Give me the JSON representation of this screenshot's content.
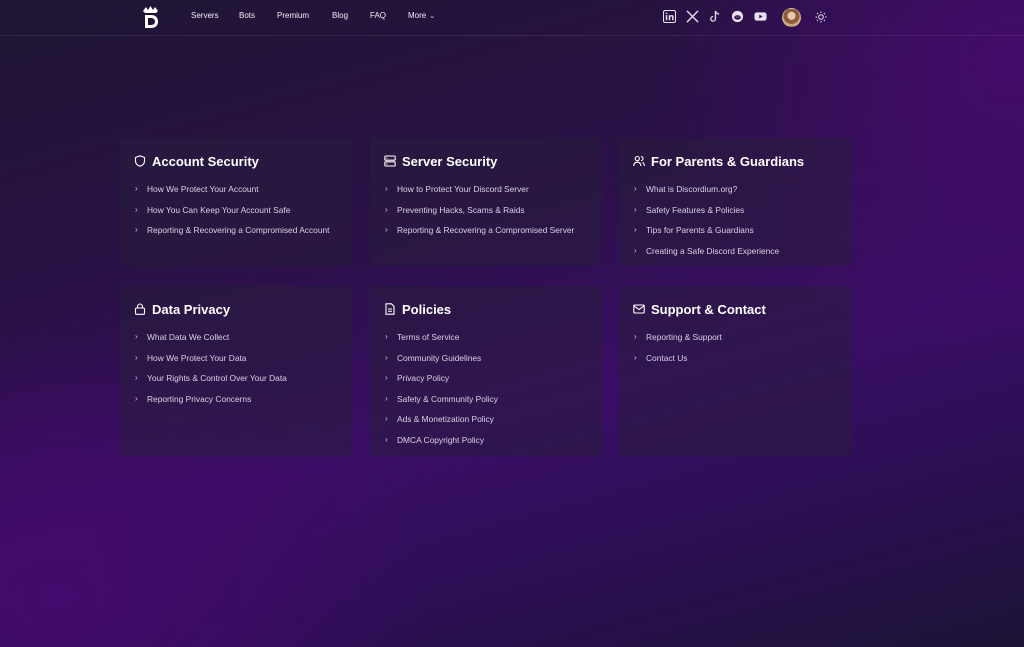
{
  "nav": {
    "items": [
      "Servers",
      "Bots",
      "Premium",
      "Blog",
      "FAQ"
    ],
    "more_label": "More",
    "socials": [
      "linkedin-icon",
      "x-icon",
      "tiktok-icon",
      "reddit-icon",
      "youtube-icon"
    ],
    "theme_icon": "sun-icon"
  },
  "cards": [
    {
      "title": "Account Security",
      "icon": "shield-icon",
      "links": [
        "How We Protect Your Account",
        "How You Can Keep Your Account Safe",
        "Reporting & Recovering a Compromised Account"
      ]
    },
    {
      "title": "Server Security",
      "icon": "server-icon",
      "links": [
        "How to Protect Your Discord Server",
        "Preventing Hacks, Scams & Raids",
        "Reporting & Recovering a Compromised Server"
      ]
    },
    {
      "title": "For Parents & Guardians",
      "icon": "users-icon",
      "links": [
        "What is Discordium.org?",
        "Safety Features & Policies",
        "Tips for Parents & Guardians",
        "Creating a Safe Discord Experience"
      ]
    },
    {
      "title": "Data Privacy",
      "icon": "lock-icon",
      "links": [
        "What Data We Collect",
        "How We Protect Your Data",
        "Your Rights & Control Over Your Data",
        "Reporting Privacy Concerns"
      ]
    },
    {
      "title": "Policies",
      "icon": "document-icon",
      "links": [
        "Terms of Service",
        "Community Guidelines",
        "Privacy Policy",
        "Safety & Community Policy",
        "Ads & Monetization Policy",
        "DMCA Copyright Policy"
      ]
    },
    {
      "title": "Support & Contact",
      "icon": "mail-icon",
      "links": [
        "Reporting & Support",
        "Contact Us"
      ]
    }
  ],
  "colors": {
    "accent": "#3a0d66",
    "card": "#281e3e",
    "text": "#d9d2e6"
  }
}
